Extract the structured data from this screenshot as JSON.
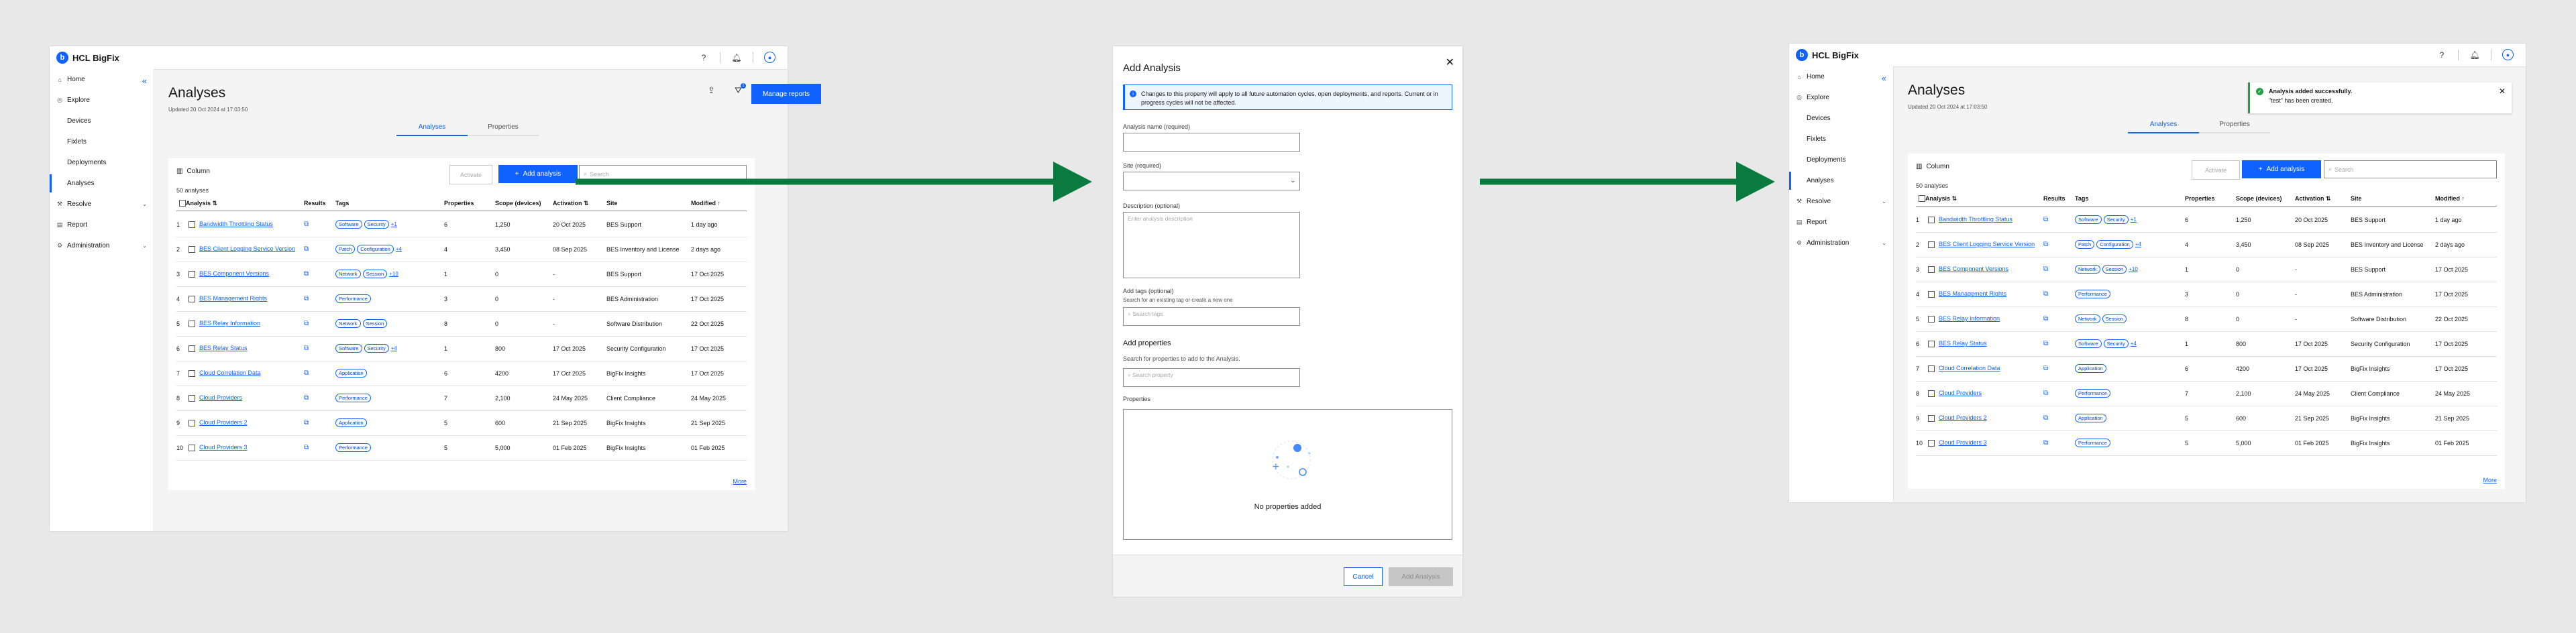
{
  "brand": "HCL BigFix",
  "colors": {
    "accent": "#0f62fe",
    "arrow": "#0a7a3e",
    "success": "#24a148"
  },
  "icons": {
    "help": "help-icon",
    "bell": "notification-icon",
    "user": "user-avatar-icon",
    "upload": "upload-icon",
    "filter": "filter-icon",
    "column": "column-icon",
    "launch": "launch-icon",
    "search": "search-icon",
    "info": "info-icon",
    "check": "checkmark-icon",
    "close": "close-icon"
  },
  "nav": {
    "home": "Home",
    "explore": "Explore",
    "devices": "Devices",
    "fixlets": "Fixlets",
    "deployments": "Deployments",
    "analyses": "Analyses",
    "resolve": "Resolve",
    "report": "Report",
    "administration": "Administration"
  },
  "page": {
    "title": "Analyses",
    "updated": "Updated 20 Oct 2024 at 17:03:50",
    "manage_reports": "Manage reports",
    "tabs": [
      "Analyses",
      "Properties"
    ],
    "column_btn": "Column",
    "activate_btn": "Activate",
    "add_btn": "Add analysis",
    "search_placeholder": "Search",
    "count": "50 analyses",
    "more": "More",
    "filter_badge": "1",
    "headers": [
      "Analysis",
      "Results",
      "Tags",
      "Properties",
      "Scope (devices)",
      "Activation",
      "Site",
      "Modified"
    ],
    "rows": [
      {
        "n": "1",
        "name": "Bandwidth Throttling Status",
        "tags": [
          "Software",
          "Security"
        ],
        "more": "+1",
        "props": "6",
        "scope": "1,250",
        "act": "20 Oct 2025",
        "site": "BES Support",
        "mod": "1 day ago"
      },
      {
        "n": "2",
        "name": "BES Client Logging Service Version",
        "tags": [
          "Patch",
          "Configuration"
        ],
        "more": "+4",
        "props": "4",
        "scope": "3,450",
        "act": "08 Sep 2025",
        "site": "BES Inventory and License",
        "mod": "2 days ago"
      },
      {
        "n": "3",
        "name": "BES Component Versions",
        "tags": [
          "Network",
          "Session"
        ],
        "more": "+10",
        "props": "1",
        "scope": "0",
        "act": "-",
        "site": "BES Support",
        "mod": "17 Oct 2025"
      },
      {
        "n": "4",
        "name": "BES Management Rights",
        "tags": [
          "Performance"
        ],
        "more": "",
        "props": "3",
        "scope": "0",
        "act": "-",
        "site": "BES Administration",
        "mod": "17 Oct 2025"
      },
      {
        "n": "5",
        "name": "BES Relay Information",
        "tags": [
          "Network",
          "Session"
        ],
        "more": "",
        "props": "8",
        "scope": "0",
        "act": "-",
        "site": "Software Distribution",
        "mod": "22 Oct 2025"
      },
      {
        "n": "6",
        "name": "BES Relay Status",
        "tags": [
          "Software",
          "Security"
        ],
        "more": "+4",
        "props": "1",
        "scope": "800",
        "act": "17 Oct 2025",
        "site": "Security Configuration",
        "mod": "17 Oct 2025"
      },
      {
        "n": "7",
        "name": "Cloud Correlation Data",
        "tags": [
          "Application"
        ],
        "more": "",
        "props": "6",
        "scope": "4200",
        "act": "17 Oct 2025",
        "site": "BigFix Insights",
        "mod": "17 Oct 2025"
      },
      {
        "n": "8",
        "name": "Cloud Providers",
        "tags": [
          "Performance"
        ],
        "more": "",
        "props": "7",
        "scope": "2,100",
        "act": "24 May 2025",
        "site": "Client Compliance",
        "mod": "24 May 2025"
      },
      {
        "n": "9",
        "name": "Cloud Providers 2",
        "tags": [
          "Application"
        ],
        "more": "",
        "props": "5",
        "scope": "600",
        "act": "21 Sep 2025",
        "site": "BigFix Insights",
        "mod": "21 Sep 2025"
      },
      {
        "n": "10",
        "name": "Cloud Providers 3",
        "tags": [
          "Performance"
        ],
        "more": "",
        "props": "5",
        "scope": "5,000",
        "act": "01 Feb 2025",
        "site": "BigFix Insights",
        "mod": "01 Feb 2025"
      }
    ]
  },
  "modal": {
    "title": "Add Analysis",
    "info": "Changes to this property will apply to all future automation cycles, open deployments, and reports. Current or in progress cycles will not be affected.",
    "name_label": "Analysis name (required)",
    "site_label": "Site (required)",
    "desc_label": "Description (optional)",
    "desc_placeholder": "Enter analysis description",
    "tags_label": "Add tags (optional)",
    "tags_help": "Search for an existing tag or create a new one",
    "tags_placeholder": "Search tags",
    "props_title": "Add properties",
    "props_help": "Search for properties to add to the Analysis.",
    "props_placeholder": "Search property",
    "props_list_label": "Properties",
    "empty": "No properties added",
    "cancel": "Cancel",
    "submit": "Add Analysis"
  },
  "toast": {
    "title": "Analysis added successfully.",
    "subtitle": "\"test\" has been created."
  }
}
